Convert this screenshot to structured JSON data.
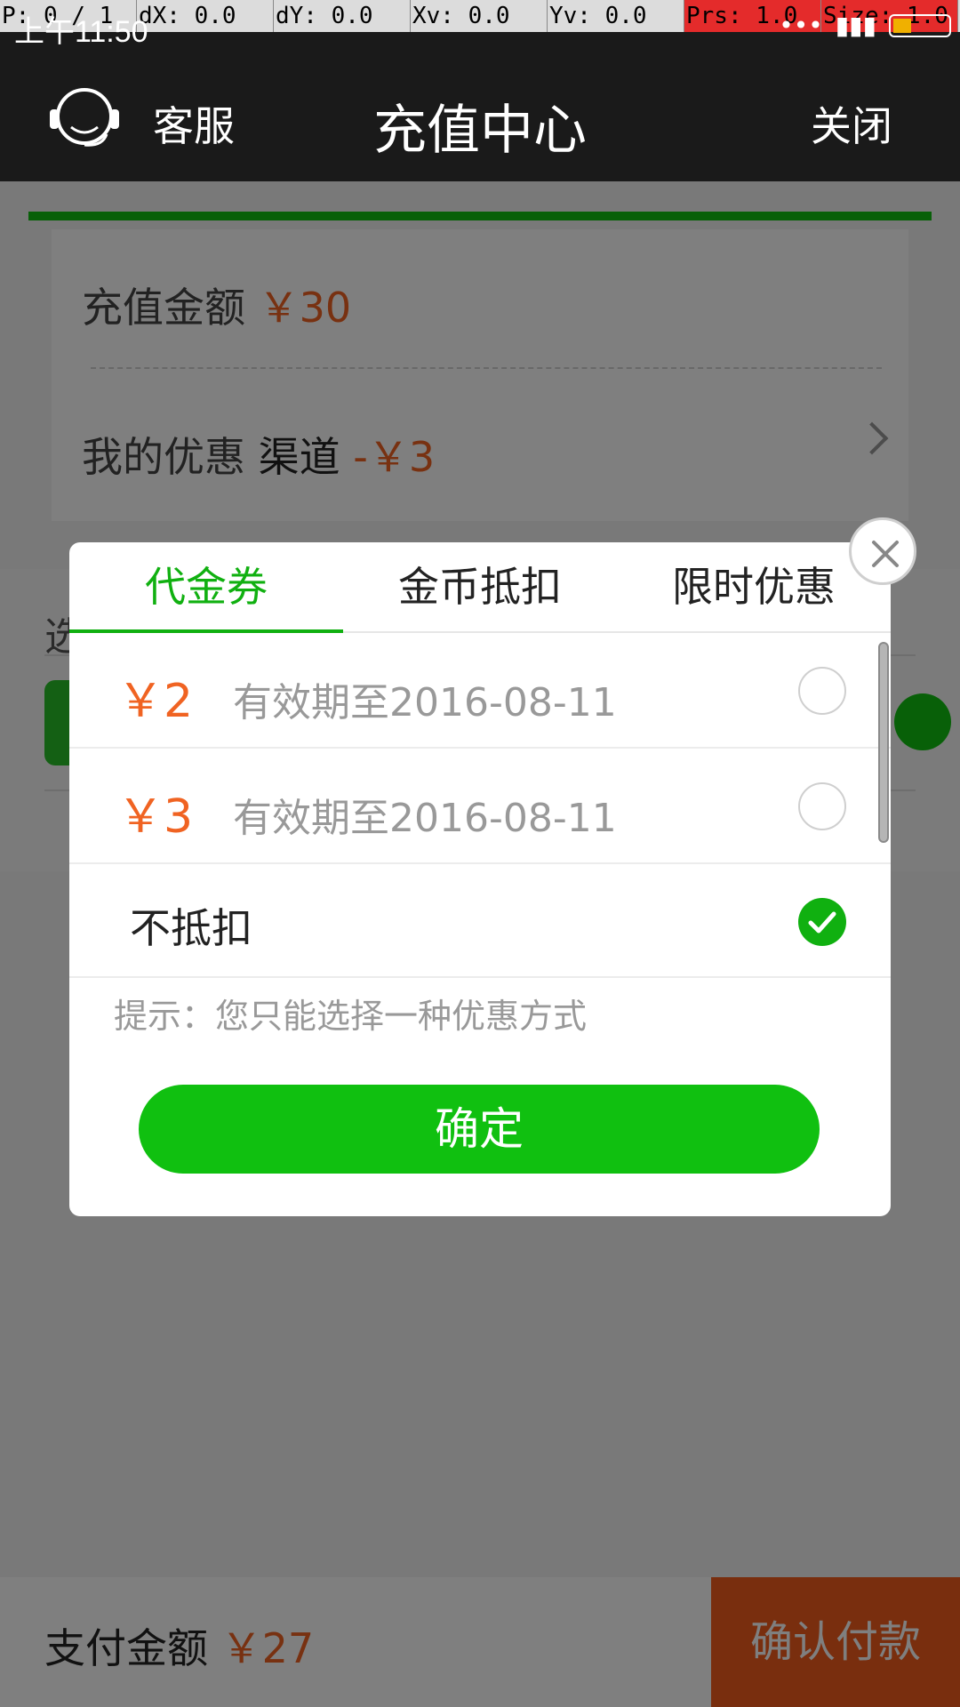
{
  "debug_bar": {
    "cells": [
      "P: 0 / 1",
      "dX: 0.0",
      "dY: 0.0",
      "Xv: 0.0",
      "Yv: 0.0",
      "Prs: 1.0",
      "Size: 1.0"
    ]
  },
  "status_bar": {
    "time": "上午11:50"
  },
  "header": {
    "service_label": "客服",
    "title": "充值中心",
    "close_label": "关闭"
  },
  "summary": {
    "recharge_label": "充值金额",
    "recharge_value": "￥30",
    "discount_label": "我的优惠",
    "discount_channel": "渠道",
    "discount_value": "-￥3"
  },
  "payment": {
    "section_title": "选"
  },
  "modal": {
    "tabs": [
      {
        "label": "代金券",
        "active": true
      },
      {
        "label": "金币抵扣",
        "active": false
      },
      {
        "label": "限时优惠",
        "active": false
      }
    ],
    "coupons": [
      {
        "amount": "￥2",
        "expiry": "有效期至2016-08-11",
        "selected": false
      },
      {
        "amount": "￥3",
        "expiry": "有效期至2016-08-11",
        "selected": false
      }
    ],
    "no_discount_label": "不抵扣",
    "no_discount_selected": true,
    "hint": "提示：您只能选择一种优惠方式",
    "confirm_label": "确定"
  },
  "footer": {
    "pay_label": "支付金额",
    "pay_value": "￥27",
    "confirm_pay_label": "确认付款"
  },
  "colors": {
    "accent_green": "#10b010",
    "price_orange": "#f06322",
    "confirm_orange": "#f25c1c",
    "header_bg": "#1a1a1a"
  },
  "icons": [
    "headset-icon",
    "chevron-right-icon",
    "wechat-icon",
    "check-icon",
    "close-icon",
    "battery-icon",
    "signal-icon"
  ]
}
